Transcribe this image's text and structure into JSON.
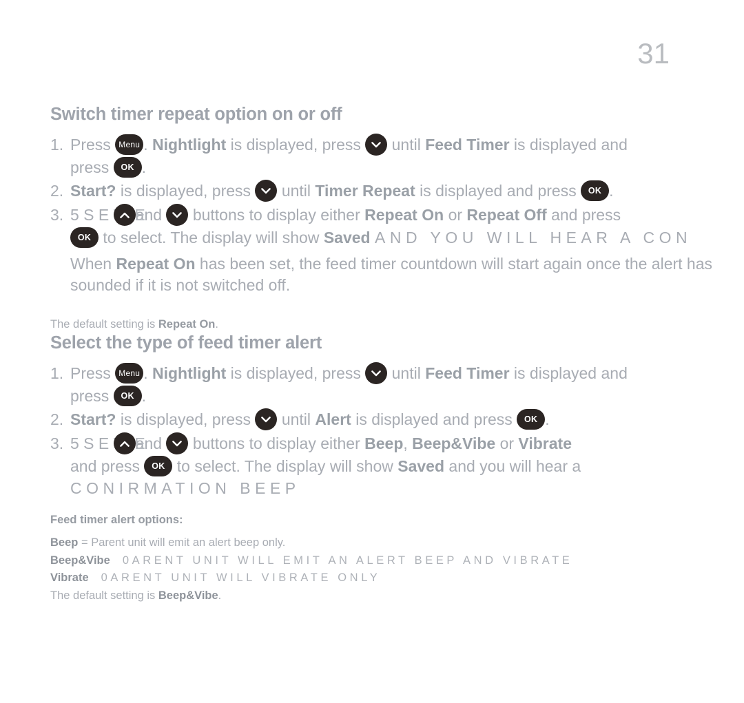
{
  "page": {
    "number": "31"
  },
  "sections": [
    {
      "id": "switch-timer-repeat",
      "heading": "Switch timer repeat option on or off",
      "steps": [
        {
          "num": "1.",
          "parts": {
            "press": "Press",
            "button_menu": "Menu",
            "after_menu": ".",
            "nightlight": "Nightlight",
            "is_displayed_press": "is displayed, press",
            "until": "until",
            "feed_timer": "Feed Timer",
            "is_displayed_and": "is displayed and",
            "press2": "press",
            "button_ok": "OK",
            "period": "."
          }
        },
        {
          "num": "2.",
          "parts": {
            "start": "Start?",
            "is_displayed_press": "is displayed, press",
            "until": "until",
            "timer_repeat": "Timer Repeat",
            "is_displayed_and_press": "is displayed and press",
            "button_ok": "OK",
            "period": "."
          }
        },
        {
          "num": "3.",
          "parts": {
            "garbled_use": "5 S E",
            "hidden_the": "THE",
            "and": "and",
            "buttons_to_display_either": "buttons to display either",
            "repeat_on": "Repeat On",
            "or": "or",
            "repeat_off": "Repeat Off",
            "and_press": "and press",
            "button_ok": "OK",
            "to_select": "to select. The display will show",
            "saved": "Saved",
            "caps_tail": "AND YOU WILL HEAR A CON"
          }
        }
      ],
      "note": {
        "when": "When",
        "repeat_on": "Repeat On",
        "rest": "has been set, the feed timer countdown will start again once the alert has sounded if it is not switched off."
      },
      "default_setting": {
        "prefix": "The default setting is",
        "value": "Repeat On",
        "suffix": "."
      }
    },
    {
      "id": "select-alert-type",
      "heading": "Select the type of feed timer alert",
      "steps": [
        {
          "num": "1.",
          "parts": {
            "press": "Press",
            "button_menu": "Menu",
            "after_menu": ".",
            "nightlight": "Nightlight",
            "is_displayed_press": "is displayed, press",
            "until": "until",
            "feed_timer": "Feed Timer",
            "is_displayed_and": "is displayed and",
            "press2": "press",
            "button_ok": "OK",
            "period": "."
          }
        },
        {
          "num": "2.",
          "parts": {
            "start": "Start?",
            "is_displayed_press": "is displayed, press",
            "until": "until",
            "alert": "Alert",
            "is_displayed_and_press": "is displayed and press",
            "button_ok": "OK",
            "period": "."
          }
        },
        {
          "num": "3.",
          "parts": {
            "garbled_use": "5 S E",
            "hidden_the": "THE",
            "and": "and",
            "buttons_to_display_either": "buttons to display either",
            "beep": "Beep",
            "comma": ",",
            "beep_vibe": "Beep&Vibe",
            "or": "or",
            "vibrate": "Vibrate",
            "and_press": "and press",
            "button_ok": "OK",
            "to_select": "to select. The display will show",
            "saved": "Saved",
            "and_you_will_hear_a": "and you will hear a",
            "caps_tail": "CONIRMATION BEEP"
          }
        }
      ],
      "options": {
        "title": "Feed timer alert options:",
        "rows": [
          {
            "label": "Beep",
            "separator": "=",
            "text": "Parent unit will emit  an alert beep only.",
            "caps": false
          },
          {
            "label": "Beep&Vibe",
            "separator": "",
            "text": "0ARENT UNIT WILL EMIT AN ALERT BEEP AND VIBRATE",
            "caps": true
          },
          {
            "label": "Vibrate",
            "separator": "",
            "text": "0ARENT UNIT WILL VIBRATE ONLY",
            "caps": true
          }
        ]
      },
      "default_setting": {
        "prefix": "The default setting is",
        "value": "Beep&Vibe",
        "suffix": "."
      }
    }
  ],
  "colors": {
    "body_text": "#a8acb3",
    "bold_text": "#9aa0a7",
    "heading": "#9ea3ab",
    "page_number": "#b9bcc0",
    "button_fill": "#2b2523",
    "button_glyph": "#ffffff",
    "background": "#ffffff"
  },
  "icons": {
    "menu_button": "menu-button-icon",
    "ok_button": "ok-button-icon",
    "up_chevron": "chevron-up-icon",
    "down_chevron": "chevron-down-icon"
  }
}
